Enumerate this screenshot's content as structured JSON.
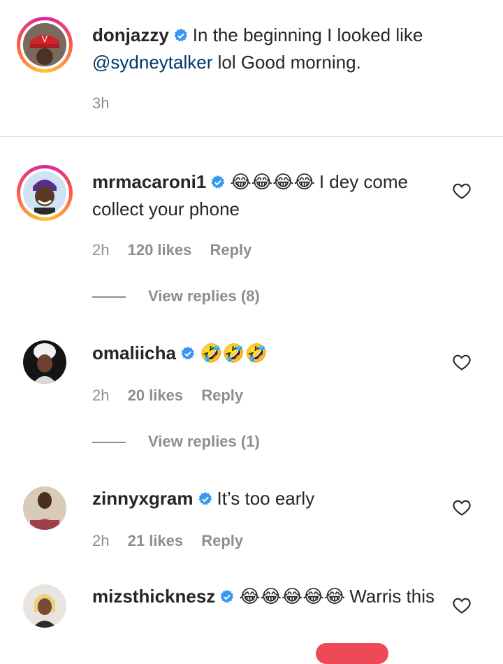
{
  "caption": {
    "username": "donjazzy",
    "text_before": "In the beginning I looked like",
    "mention": "@sydneytalker",
    "text_after": " lol Good morning.",
    "time": "3h"
  },
  "comments": [
    {
      "username": "mrmacaroni1",
      "emoji": "😂😂😂😂",
      "text": "I dey come collect your phone",
      "time": "2h",
      "likes": "120 likes",
      "reply": "Reply",
      "view_replies": "View replies (8)"
    },
    {
      "username": "omaliicha",
      "emoji": "🤣🤣🤣",
      "text": "",
      "time": "2h",
      "likes": "20 likes",
      "reply": "Reply",
      "view_replies": "View replies (1)"
    },
    {
      "username": "zinnyxgram",
      "emoji": "",
      "text": "It’s too early",
      "time": "2h",
      "likes": "21 likes",
      "reply": "Reply"
    },
    {
      "username": "mizsthicknesz",
      "emoji": "😂😂😂😂😂",
      "text": "Warris this"
    }
  ],
  "icons": {
    "verified": "verified-badge-icon",
    "like": "heart-icon"
  },
  "colors": {
    "verified": "#3897f0",
    "meta": "#8e8e8e",
    "mention": "#00376b",
    "emoji": "#fdc830"
  }
}
